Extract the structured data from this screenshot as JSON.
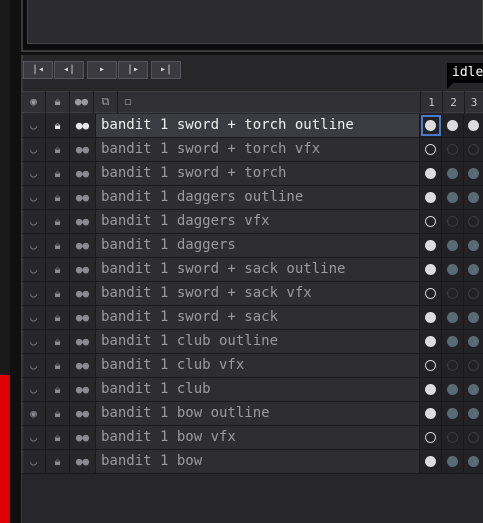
{
  "tooltip": {
    "label": "idle"
  },
  "playback": {
    "buttons": [
      {
        "name": "first-frame-button",
        "glyph": "|◂"
      },
      {
        "name": "prev-frame-button",
        "glyph": "◂|"
      },
      {
        "name": "play-button",
        "glyph": "▸"
      },
      {
        "name": "next-frame-button",
        "glyph": "|▸"
      },
      {
        "name": "last-frame-button",
        "glyph": "▸|"
      }
    ]
  },
  "header": {
    "icons": [
      "eye-icon",
      "lock-icon",
      "link-icon",
      "layer-stack-icon",
      "frame-toggle-icon"
    ],
    "frames": [
      "1",
      "2",
      "3"
    ]
  },
  "layers": [
    {
      "label": "bandit 1 sword + torch outline",
      "selected": true,
      "kind": "outline",
      "visible": false
    },
    {
      "label": "bandit 1 sword + torch vfx",
      "selected": false,
      "kind": "vfx",
      "visible": false
    },
    {
      "label": "bandit 1 sword + torch",
      "selected": false,
      "kind": "base",
      "visible": false
    },
    {
      "label": "bandit 1 daggers outline",
      "selected": false,
      "kind": "outline",
      "visible": false
    },
    {
      "label": "bandit 1 daggers vfx",
      "selected": false,
      "kind": "vfx",
      "visible": false
    },
    {
      "label": "bandit 1 daggers",
      "selected": false,
      "kind": "base",
      "visible": false
    },
    {
      "label": "bandit 1 sword + sack outline",
      "selected": false,
      "kind": "outline",
      "visible": false
    },
    {
      "label": "bandit 1 sword + sack vfx",
      "selected": false,
      "kind": "vfx",
      "visible": false
    },
    {
      "label": "bandit 1 sword + sack",
      "selected": false,
      "kind": "base",
      "visible": false
    },
    {
      "label": "bandit 1 club outline",
      "selected": false,
      "kind": "outline",
      "visible": false
    },
    {
      "label": "bandit 1 club vfx",
      "selected": false,
      "kind": "vfx",
      "visible": false
    },
    {
      "label": "bandit 1 club",
      "selected": false,
      "kind": "base",
      "visible": false
    },
    {
      "label": "bandit 1 bow outline",
      "selected": false,
      "kind": "outline",
      "visible": true
    },
    {
      "label": "bandit 1 bow vfx",
      "selected": false,
      "kind": "vfx",
      "visible": false
    },
    {
      "label": "bandit 1 bow",
      "selected": false,
      "kind": "base",
      "visible": false
    }
  ],
  "colors": {
    "accent": "#4a78c8",
    "panel": "#27272a",
    "warning": "#e00000"
  }
}
